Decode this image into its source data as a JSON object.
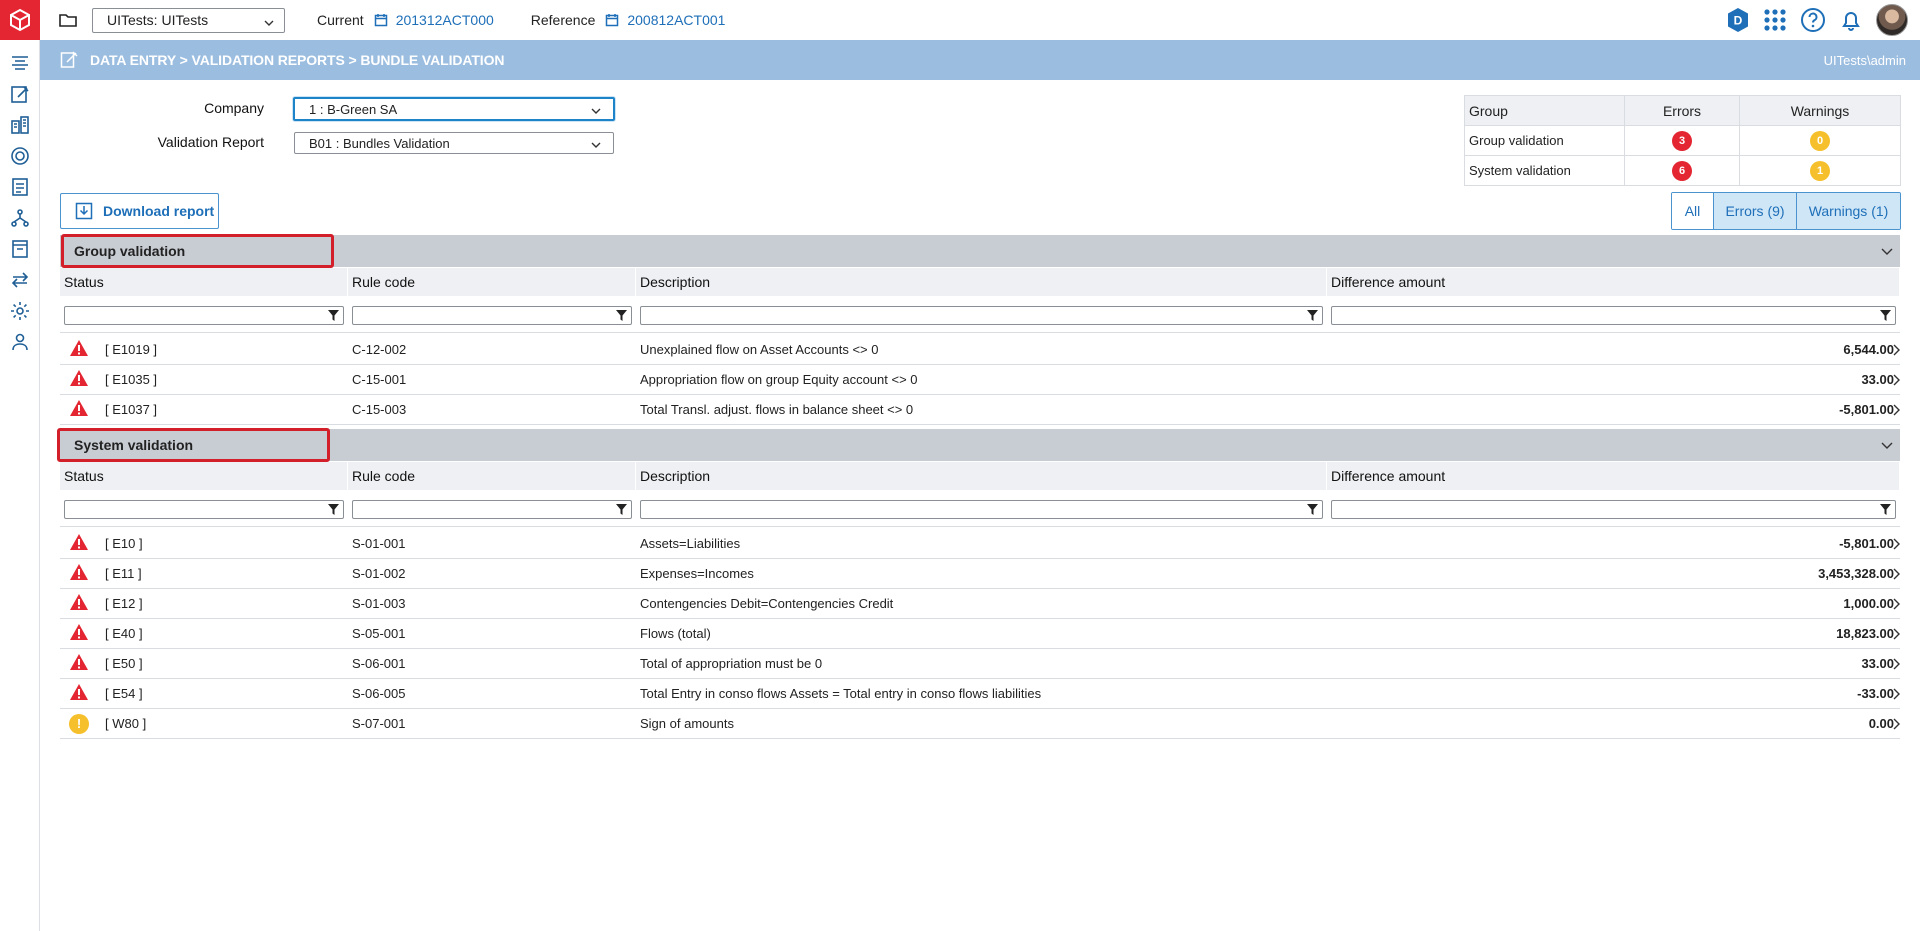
{
  "topbar": {
    "environment": "UITests: UITests",
    "current_label": "Current",
    "current_value": "201312ACT000",
    "reference_label": "Reference",
    "reference_value": "200812ACT001",
    "badge_letter": "D"
  },
  "breadcrumb": {
    "path": "DATA ENTRY > VALIDATION REPORTS > BUNDLE VALIDATION",
    "user": "UITests\\admin"
  },
  "filters": {
    "company_label": "Company",
    "company_value": "1 : B-Green SA",
    "report_label": "Validation Report",
    "report_value": "B01 : Bundles Validation"
  },
  "summary": {
    "headers": [
      "Group",
      "Errors",
      "Warnings"
    ],
    "rows": [
      {
        "group": "Group validation",
        "errors": "3",
        "warnings": "0"
      },
      {
        "group": "System validation",
        "errors": "6",
        "warnings": "1"
      }
    ]
  },
  "actions": {
    "download_label": "Download report",
    "toggles": [
      "All",
      "Errors (9)",
      "Warnings (1)"
    ]
  },
  "columns": [
    "Status",
    "Rule code",
    "Description",
    "Difference amount"
  ],
  "sections": [
    {
      "title": "Group validation",
      "rows": [
        {
          "type": "error",
          "code": "[ E1019 ]",
          "rule": "C-12-002",
          "description": "Unexplained flow on Asset Accounts <> 0",
          "amount": "6,544.00"
        },
        {
          "type": "error",
          "code": "[ E1035 ]",
          "rule": "C-15-001",
          "description": "Appropriation flow on group Equity account <> 0",
          "amount": "33.00"
        },
        {
          "type": "error",
          "code": "[ E1037 ]",
          "rule": "C-15-003",
          "description": "Total Transl. adjust. flows in balance sheet <> 0",
          "amount": "-5,801.00"
        }
      ]
    },
    {
      "title": "System validation",
      "rows": [
        {
          "type": "error",
          "code": "[ E10 ]",
          "rule": "S-01-001",
          "description": "Assets=Liabilities",
          "amount": "-5,801.00"
        },
        {
          "type": "error",
          "code": "[ E11 ]",
          "rule": "S-01-002",
          "description": "Expenses=Incomes",
          "amount": "3,453,328.00"
        },
        {
          "type": "error",
          "code": "[ E12 ]",
          "rule": "S-01-003",
          "description": "Contengencies Debit=Contengencies Credit",
          "amount": "1,000.00"
        },
        {
          "type": "error",
          "code": "[ E40 ]",
          "rule": "S-05-001",
          "description": "Flows (total)",
          "amount": "18,823.00"
        },
        {
          "type": "error",
          "code": "[ E50 ]",
          "rule": "S-06-001",
          "description": "Total of appropriation must be 0",
          "amount": "33.00"
        },
        {
          "type": "error",
          "code": "[ E54 ]",
          "rule": "S-06-005",
          "description": "Total Entry in conso flows Assets = Total entry in conso flows liabilities",
          "amount": "-33.00"
        },
        {
          "type": "warning",
          "code": "[ W80 ]",
          "rule": "S-07-001",
          "description": "Sign of amounts",
          "amount": "0.00"
        }
      ]
    }
  ],
  "warning_glyph": "!",
  "colors": {
    "accent": "#1e6fb8",
    "error": "#e32631",
    "warning": "#f6c02c",
    "breadcrumb_bg": "#9bbde0",
    "section_bg": "#c8ccd3",
    "highlight": "#d21f2a"
  }
}
